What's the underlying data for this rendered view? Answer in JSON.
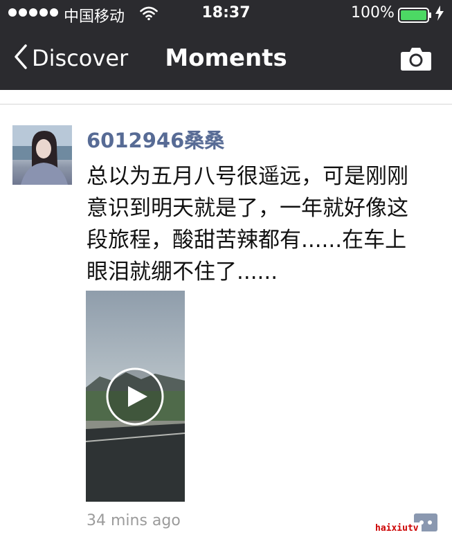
{
  "status_bar": {
    "carrier": "中国移动",
    "time": "18:37",
    "battery": "100%",
    "signal_icon": "signal-dots-icon",
    "wifi_icon": "wifi-icon",
    "battery_icon": "battery-full-icon",
    "charging_icon": "lightning-bolt-icon"
  },
  "nav": {
    "back_label": "Discover",
    "title": "Moments",
    "back_icon": "chevron-left-icon",
    "camera_icon": "camera-icon"
  },
  "post": {
    "username": "6012946桑桑",
    "text": "总以为五月八号很遥远，可是刚刚\n意识到明天就是了，一年就好像这\n段旅程，酸甜苦辣都有......在车上\n眼泪就绷不住了......",
    "timestamp": "34 mins ago",
    "video_icon": "play-icon",
    "more_icon": "comment-more-icon"
  },
  "watermark": "haixiutv",
  "colors": {
    "nav_background": "#2b2b2f",
    "username": "#576b95",
    "timestamp": "#9b9b9b",
    "watermark": "#cc0000"
  }
}
